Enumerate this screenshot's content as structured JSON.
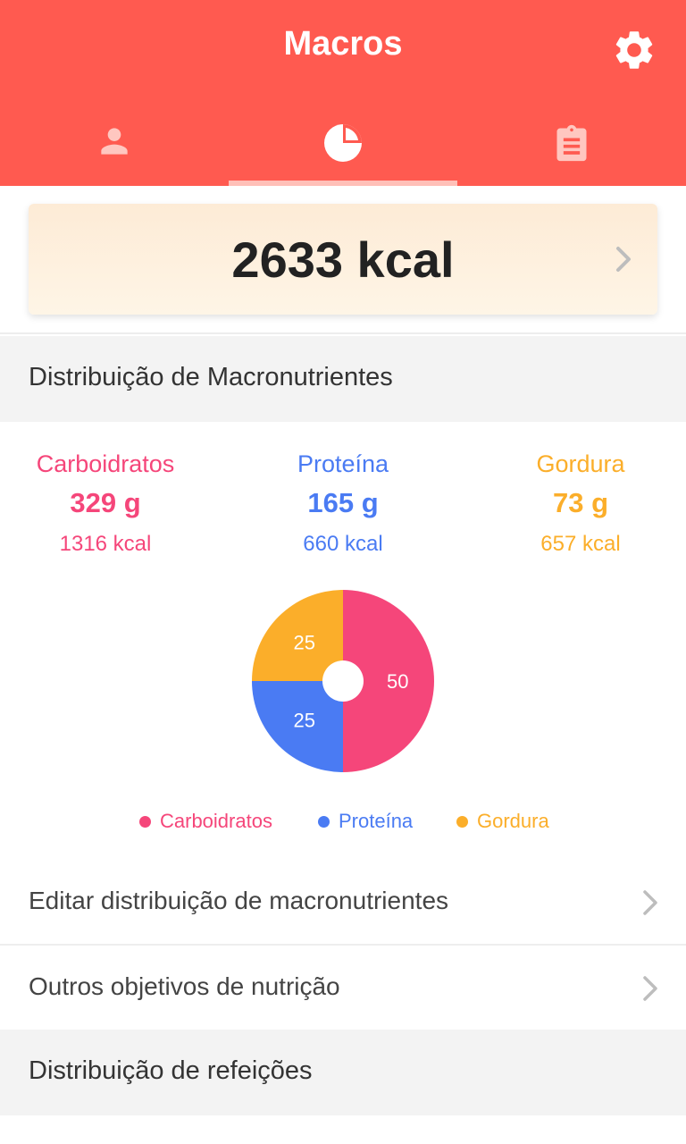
{
  "header": {
    "title": "Macros",
    "tabs": [
      {
        "icon": "person-icon",
        "active": false
      },
      {
        "icon": "pie-chart-icon",
        "active": true
      },
      {
        "icon": "clipboard-icon",
        "active": false
      }
    ]
  },
  "calories": {
    "value": "2633 kcal"
  },
  "macro_section": {
    "title": "Distribuição de Macronutrientes"
  },
  "macros": [
    {
      "name": "Carboidratos",
      "grams": "329 g",
      "kcal": "1316 kcal",
      "color": "#F5467A"
    },
    {
      "name": "Proteína",
      "grams": "165 g",
      "kcal": "660 kcal",
      "color": "#4A7BF3"
    },
    {
      "name": "Gordura",
      "grams": "73 g",
      "kcal": "657 kcal",
      "color": "#FBAE2A"
    }
  ],
  "chart_data": {
    "type": "pie",
    "categories": [
      "Carboidratos",
      "Proteína",
      "Gordura"
    ],
    "values": [
      50,
      25,
      25
    ],
    "colors": [
      "#F5467A",
      "#4A7BF3",
      "#FBAE2A"
    ],
    "legend_position": "bottom"
  },
  "menu": {
    "edit_distribution": "Editar distribuição de macronutrientes",
    "other_goals": "Outros objetivos de nutrição"
  },
  "meals_section": {
    "title": "Distribuição de refeições"
  },
  "colors": {
    "primary": "#FF5A50",
    "section_bg": "#F3F3F3"
  }
}
